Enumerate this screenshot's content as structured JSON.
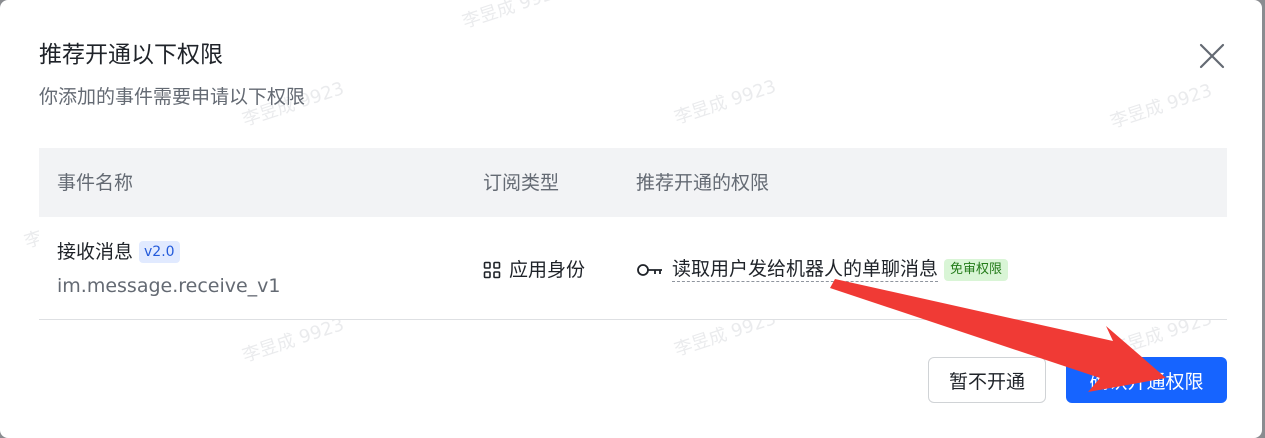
{
  "dialog": {
    "title": "推荐开通以下权限",
    "subtitle": "你添加的事件需要申请以下权限"
  },
  "table": {
    "headers": [
      "事件名称",
      "订阅类型",
      "推荐开通的权限"
    ],
    "rows": [
      {
        "event_name": "接收消息",
        "version": "v2.0",
        "event_key": "im.message.receive_v1",
        "subscription_type": "应用身份",
        "permission": "读取用户发给机器人的单聊消息",
        "permission_badge": "免审权限"
      }
    ]
  },
  "buttons": {
    "cancel": "暂不开通",
    "confirm": "确认开通权限"
  },
  "watermark": "李昱成 9923",
  "icons": {
    "close": "close-icon",
    "subscription": "grid-icon",
    "permission": "key-icon"
  },
  "colors": {
    "primary": "#1664ff",
    "badge_bg": "#d9f5d6",
    "badge_text": "#237b19",
    "version_bg": "#e1eaff",
    "annotation_arrow": "#f03a35"
  }
}
